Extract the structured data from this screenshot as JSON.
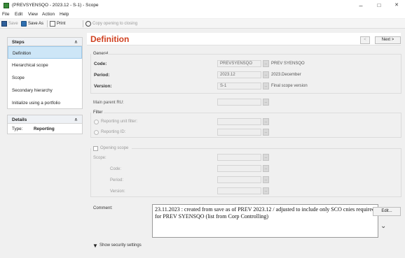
{
  "window": {
    "title": "(PREVSYENSQO - 2023.12 - S-1) - Scope",
    "minimize": "–",
    "maximize": "□",
    "close": "✕"
  },
  "menu": [
    "File",
    "Edit",
    "View",
    "Action",
    "Help"
  ],
  "toolbar": {
    "save": "Save",
    "save_as": "Save As",
    "print": "Print",
    "copy_opening": "Copy opening to closing"
  },
  "steps_panel": {
    "title": "Steps",
    "items": [
      {
        "label": "Definition",
        "active": true
      },
      {
        "label": "Hierarchical scope",
        "active": false
      },
      {
        "label": "Scope",
        "active": false
      },
      {
        "label": "Secondary hierarchy",
        "active": false
      },
      {
        "label": "Initialize using a portfolio",
        "active": false
      }
    ]
  },
  "details_panel": {
    "title": "Details",
    "type_label": "Type:",
    "type_value": "Reporting"
  },
  "main": {
    "title": "Definition",
    "prev_label": "<",
    "next_label": "Next >",
    "general": {
      "group_label": "General",
      "code_label": "Code:",
      "code_value": "PREVSYENSQO",
      "code_desc": "PREV SYENSQO",
      "period_label": "Period:",
      "period_value": "2023.12",
      "period_desc": "2023.December",
      "version_label": "Version:",
      "version_value": "S-1",
      "version_desc": "Final scope version"
    },
    "main_parent_label": "Main parent RU:",
    "filter": {
      "group_label": "Filter",
      "reporting_unit_filter": "Reporting unit filter:",
      "reporting_id": "Reporting ID:"
    },
    "opening": {
      "checkbox_label": "Opening scope",
      "scope_label": "Scope:",
      "code_label": "Code:",
      "period_label": "Period:",
      "version_label": "Version:"
    },
    "comment_label": "Comment:",
    "comment_text": "23.11.2023 : created from save as of PREV 2023.12 / adjusted to include only SCO cnies required for PREV SYENSQO (list from Corp Controlling)",
    "edit_button": "Edit...",
    "security_toggle": "Show security settings"
  }
}
